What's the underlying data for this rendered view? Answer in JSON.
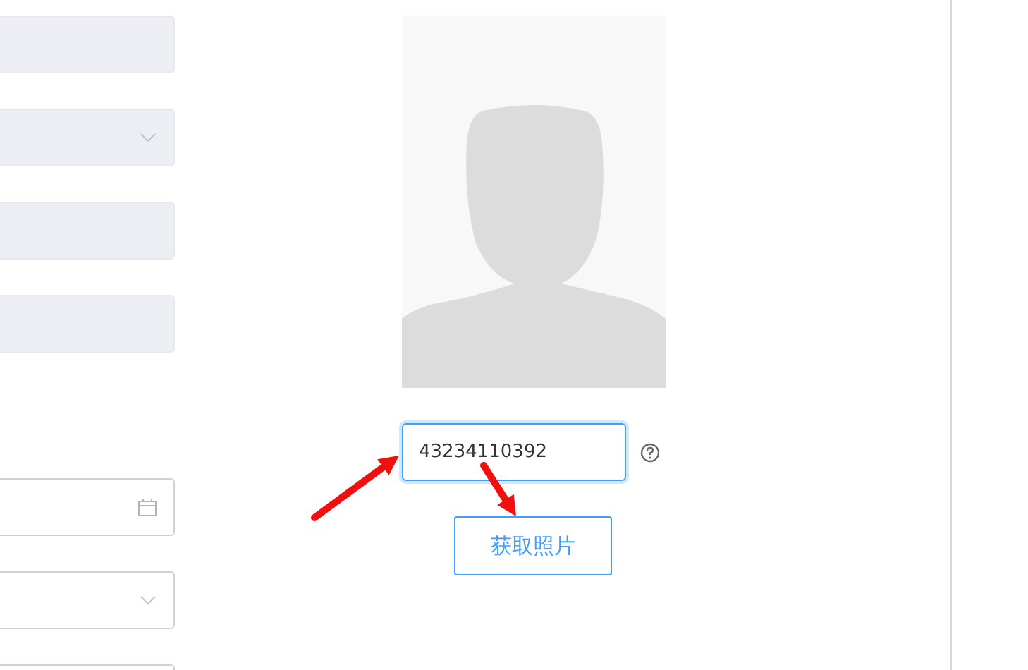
{
  "form_fields": [
    {
      "kind": "text",
      "disabled": true,
      "gap_before": false
    },
    {
      "kind": "select",
      "disabled": true,
      "gap_before": false
    },
    {
      "kind": "text",
      "disabled": true,
      "gap_before": false
    },
    {
      "kind": "text",
      "disabled": true,
      "gap_before": false
    },
    {
      "kind": "date",
      "disabled": false,
      "gap_before": true
    },
    {
      "kind": "select",
      "disabled": false,
      "gap_before": false
    },
    {
      "kind": "text",
      "disabled": false,
      "gap_before": false
    }
  ],
  "photo": {
    "kind": "avatar-placeholder"
  },
  "id_input": {
    "value": "43234110392",
    "focused": true
  },
  "fetch_button": {
    "label": "获取照片"
  },
  "annotations": [
    {
      "kind": "arrow"
    },
    {
      "kind": "arrow"
    }
  ]
}
